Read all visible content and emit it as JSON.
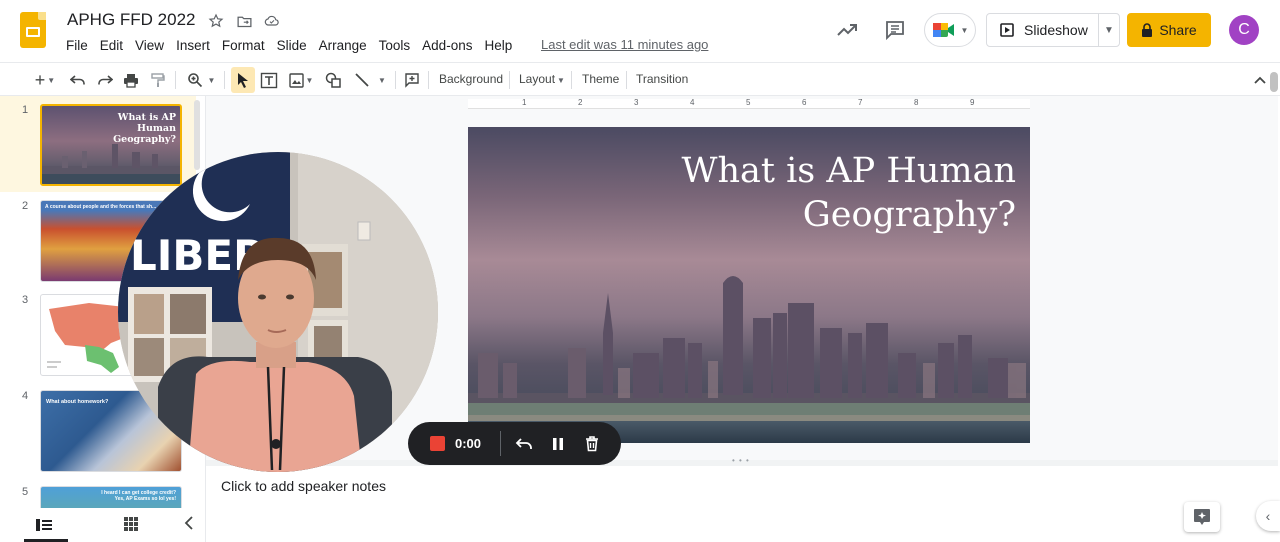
{
  "header": {
    "doc_title": "APHG FFD 2022",
    "last_edit": "Last edit was 11 minutes ago",
    "menu": [
      "File",
      "Edit",
      "View",
      "Insert",
      "Format",
      "Slide",
      "Arrange",
      "Tools",
      "Add-ons",
      "Help"
    ],
    "slideshow_label": "Slideshow",
    "share_label": "Share",
    "avatar_initial": "C"
  },
  "toolbar": {
    "background_label": "Background",
    "layout_label": "Layout",
    "theme_label": "Theme",
    "transition_label": "Transition"
  },
  "ruler": {
    "labels": [
      "1",
      "2",
      "3",
      "4",
      "5",
      "6",
      "7",
      "8",
      "9"
    ]
  },
  "filmstrip": {
    "slides": [
      {
        "number": "1",
        "title": "What is AP Human Geography?"
      },
      {
        "number": "2",
        "title": "A course about people and the forces that sh..."
      },
      {
        "number": "3",
        "title": ""
      },
      {
        "number": "4",
        "title": "What about homework?"
      },
      {
        "number": "5",
        "title": "I heard I can get college credit? Yes, AP Exams so lol yes!"
      }
    ]
  },
  "slide": {
    "title_line1": "What is AP Human",
    "title_line2": "Geography?"
  },
  "notes": {
    "placeholder": "Click to add speaker notes"
  },
  "recorder": {
    "time": "0:00"
  },
  "colors": {
    "accent": "#f4b400",
    "avatar": "#a142c4",
    "record": "#ea4335",
    "recorder_bg": "#202124"
  }
}
